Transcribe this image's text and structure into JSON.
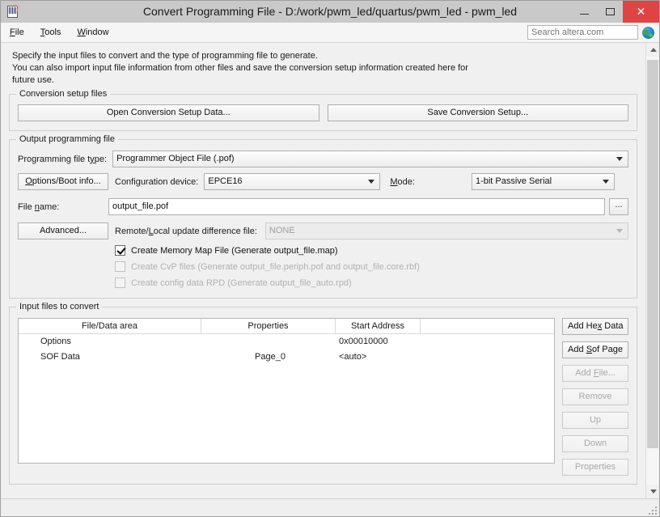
{
  "window": {
    "title": "Convert Programming File - D:/work/pwm_led/quartus/pwm_led - pwm_led",
    "app_icon": "programming-file-icon",
    "controls": {
      "minimize": "–",
      "maximize": "□",
      "close": "✕"
    }
  },
  "menubar": {
    "items": [
      {
        "label": "File",
        "mnemonic": "F"
      },
      {
        "label": "Tools",
        "mnemonic": "T"
      },
      {
        "label": "Window",
        "mnemonic": "W"
      }
    ],
    "search": {
      "placeholder": "Search altera.com",
      "value": ""
    },
    "globe_icon": "globe-icon"
  },
  "intro": {
    "line1": "Specify the input files to convert and the type of programming file to generate.",
    "line2": "You can also import input file information from other files and save the conversion setup information created here for",
    "line3": "future use."
  },
  "conversion_setup": {
    "legend": "Conversion setup files",
    "open_button": "Open Conversion Setup Data...",
    "save_button": "Save Conversion Setup..."
  },
  "output_file": {
    "legend": "Output programming file",
    "file_type_label": "Programming file type:",
    "file_type_label_mn": "t",
    "file_type_value": "Programmer Object File (.pof)",
    "options_boot_button": "Options/Boot info...",
    "config_device_label": "Configuration device:",
    "config_device_value": "EPCE16",
    "mode_label": "Mode:",
    "mode_value": "1-bit Passive Serial",
    "file_name_label": "File name:",
    "file_name_value": "output_file.pof",
    "browse_button": "...",
    "advanced_button": "Advanced...",
    "remote_local_label": "Remote/Local update difference file:",
    "remote_local_value": "NONE",
    "checkboxes": [
      {
        "label": "Create Memory Map File (Generate output_file.map)",
        "checked": true,
        "enabled": true
      },
      {
        "label": "Create CvP files (Generate output_file.periph.pof and output_file.core.rbf)",
        "checked": false,
        "enabled": false
      },
      {
        "label": "Create config data RPD (Generate output_file_auto.rpd)",
        "checked": false,
        "enabled": false
      }
    ]
  },
  "input_files": {
    "legend": "Input files to convert",
    "columns": [
      "File/Data area",
      "Properties",
      "Start Address",
      ""
    ],
    "rows": [
      {
        "file_data_area": "Options",
        "properties": "",
        "start_address": "0x00010000"
      },
      {
        "file_data_area": "SOF Data",
        "properties": "Page_0",
        "start_address": "<auto>"
      }
    ],
    "buttons": [
      {
        "label": "Add Hex Data",
        "enabled": true
      },
      {
        "label": "Add Sof Page",
        "enabled": true
      },
      {
        "label": "Add File...",
        "enabled": false
      },
      {
        "label": "Remove",
        "enabled": false
      },
      {
        "label": "Up",
        "enabled": false
      },
      {
        "label": "Down",
        "enabled": false
      },
      {
        "label": "Properties",
        "enabled": false
      }
    ]
  },
  "scrollbar": {
    "up_icon": "chevron-up-icon",
    "down_icon": "chevron-down-icon"
  },
  "colors": {
    "titlebar": "#c9c9c9",
    "close": "#e04343",
    "background": "#f0f0f0",
    "accent": "#1b7fc4"
  }
}
